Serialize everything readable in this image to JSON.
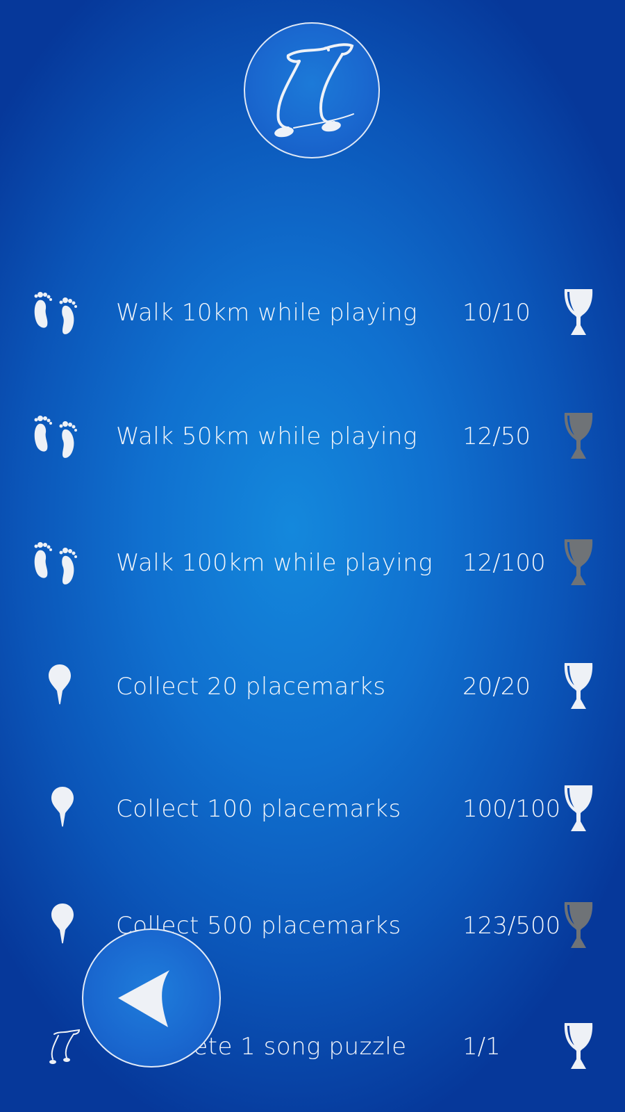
{
  "header": {
    "logo_icon": "music-note-footprints-icon"
  },
  "achievements": [
    {
      "icon": "footprints-icon",
      "label": "Walk 10km while playing",
      "progress": "10/10",
      "completed": true
    },
    {
      "icon": "footprints-icon",
      "label": "Walk 50km while playing",
      "progress": "12/50",
      "completed": false
    },
    {
      "icon": "footprints-icon",
      "label": "Walk 100km while playing",
      "progress": "12/100",
      "completed": false
    },
    {
      "icon": "placemark-icon",
      "label": "Collect 20 placemarks",
      "progress": "20/20",
      "completed": true
    },
    {
      "icon": "placemark-icon",
      "label": "Collect 100 placemarks",
      "progress": "100/100",
      "completed": true
    },
    {
      "icon": "placemark-icon",
      "label": "Collect 500 placemarks",
      "progress": "123/500",
      "completed": false
    },
    {
      "icon": "song-puzzle-icon",
      "label": "Complete 1 song puzzle",
      "progress": "1/1",
      "completed": true
    }
  ],
  "back_button": {
    "icon": "back-arrow-icon"
  },
  "colors": {
    "trophy_earned": "#eef1f6",
    "trophy_locked": "#6f7377",
    "text": "#f2f5fa"
  }
}
